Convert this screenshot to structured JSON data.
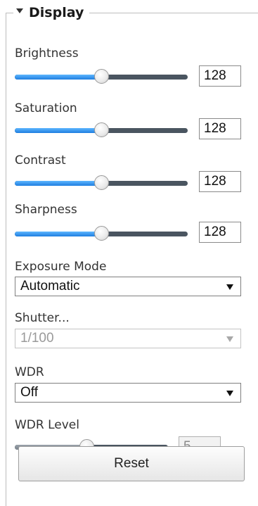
{
  "panel": {
    "title": "Display"
  },
  "brightness": {
    "label": "Brightness",
    "value": "128",
    "level_fraction": 0.5
  },
  "saturation": {
    "label": "Saturation",
    "value": "128",
    "level_fraction": 0.5
  },
  "contrast": {
    "label": "Contrast",
    "value": "128",
    "level_fraction": 0.5
  },
  "sharpness": {
    "label": "Sharpness",
    "value": "128",
    "level_fraction": 0.5
  },
  "exposure_mode": {
    "label": "Exposure Mode",
    "selected": "Automatic"
  },
  "shutter": {
    "label": "Shutter...",
    "selected": "1/100",
    "disabled": true
  },
  "wdr": {
    "label": "WDR",
    "selected": "Off"
  },
  "wdr_level": {
    "label": "WDR Level",
    "value": "5",
    "level_fraction": 0.47,
    "disabled": true
  },
  "reset_button": {
    "label": "Reset"
  },
  "colors": {
    "slider_fill": "#1f7ee0",
    "slider_track": "#4a5560"
  }
}
